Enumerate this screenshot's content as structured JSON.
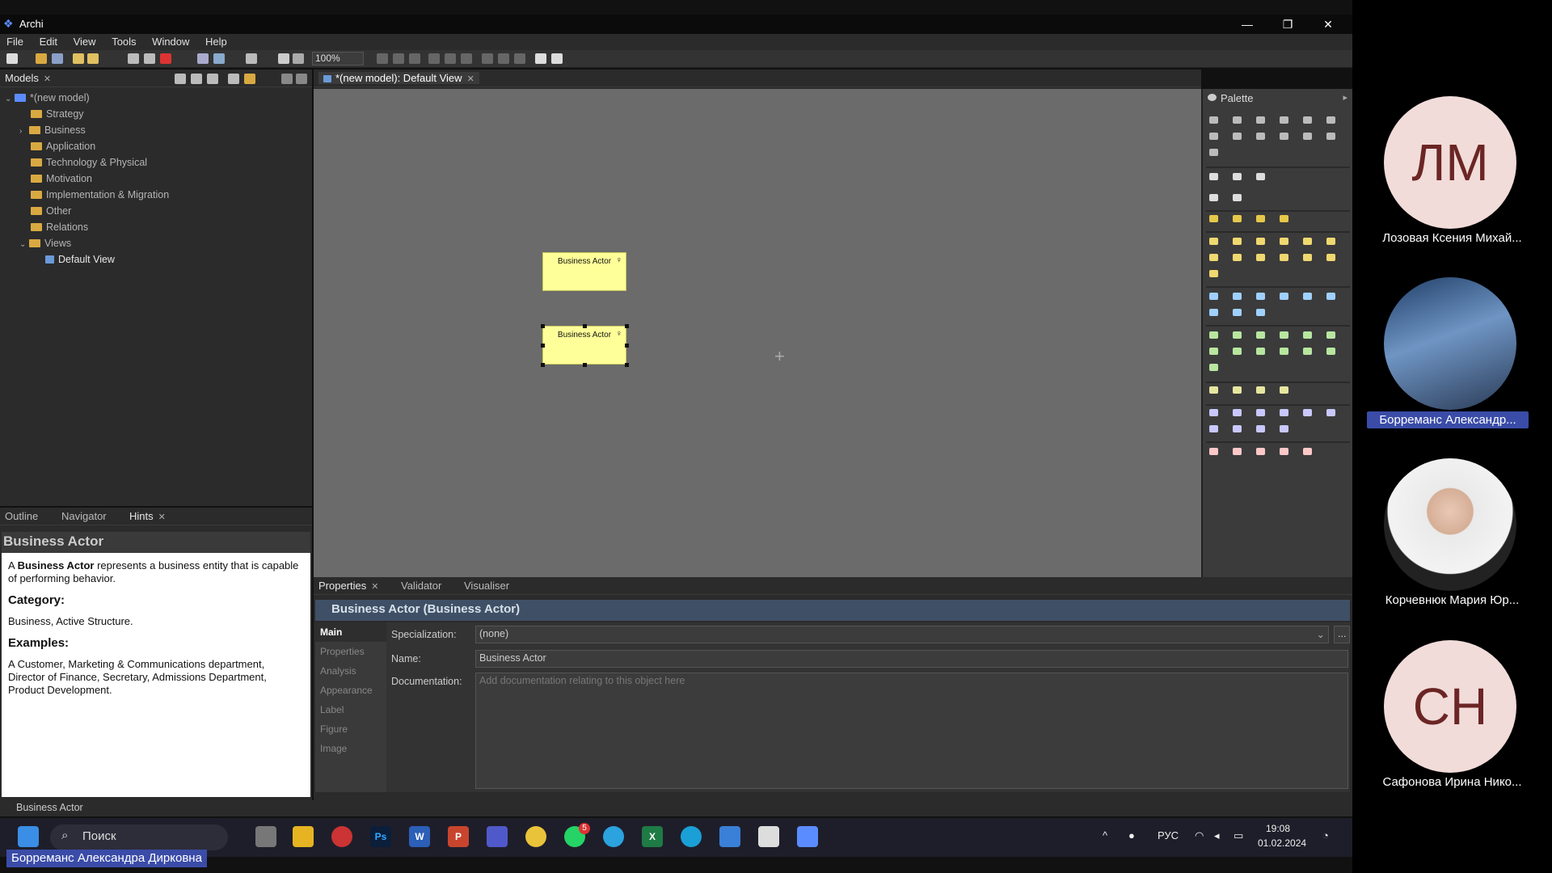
{
  "window": {
    "title": "Archi",
    "minimize": "—",
    "maximize": "❐",
    "close": "✕"
  },
  "menu": [
    "File",
    "Edit",
    "View",
    "Tools",
    "Window",
    "Help"
  ],
  "toolbar": {
    "zoom": "100%"
  },
  "models_panel": {
    "tab": "Models",
    "tree": {
      "root": "*(new model)",
      "folders": [
        "Strategy",
        "Business",
        "Application",
        "Technology & Physical",
        "Motivation",
        "Implementation & Migration",
        "Other",
        "Relations",
        "Views"
      ],
      "view": "Default View"
    }
  },
  "editor": {
    "tab": "*(new model): Default View",
    "elements": [
      {
        "label": "Business Actor"
      },
      {
        "label": "Business Actor",
        "selected": true
      }
    ]
  },
  "palette": {
    "title": "Palette"
  },
  "hints_panel": {
    "tabs": [
      "Outline",
      "Navigator",
      "Hints"
    ],
    "title": "Business Actor",
    "desc_prefix": "A ",
    "desc_bold": "Business Actor",
    "desc_rest": " represents a business entity that is capable of performing behavior.",
    "category_label": "Category:",
    "category": "Business, Active Structure.",
    "examples_label": "Examples:",
    "examples": "A Customer, Marketing & Communications department, Director of Finance, Secretary, Admissions Department, Product Development."
  },
  "properties_panel": {
    "tabs": [
      "Properties",
      "Validator",
      "Visualiser"
    ],
    "header": "Business Actor (Business Actor)",
    "sections": [
      "Main",
      "Properties",
      "Analysis",
      "Appearance",
      "Label",
      "Figure",
      "Image"
    ],
    "specialization_label": "Specialization:",
    "specialization_value": "(none)",
    "name_label": "Name:",
    "name_value": "Business Actor",
    "documentation_label": "Documentation:",
    "documentation_placeholder": "Add documentation relating to this object here",
    "more_button": "..."
  },
  "statusbar": {
    "text": "Business Actor"
  },
  "taskbar": {
    "search": "Поиск",
    "apps": [
      "Ps",
      "W",
      "P",
      "X"
    ],
    "whatsapp_badge": "5",
    "lang": "РУС",
    "time": "19:08",
    "date": "01.02.2024"
  },
  "caption": "Борреманс Александра Дирковна",
  "participants": [
    {
      "initials": "ЛМ",
      "name": "Лозовая Ксения Михай..."
    },
    {
      "name": "Борреманс Александр...",
      "speaking": true
    },
    {
      "name": "Корчевнюк Мария Юр..."
    },
    {
      "initials": "СН",
      "name": "Сафонова Ирина Нико..."
    }
  ],
  "colors": {
    "actor_fill": "#ffff99",
    "canvas": "#6b6b6b",
    "speaking_label": "#3a4ca8",
    "avatar_bg": "#f1dcd9"
  }
}
